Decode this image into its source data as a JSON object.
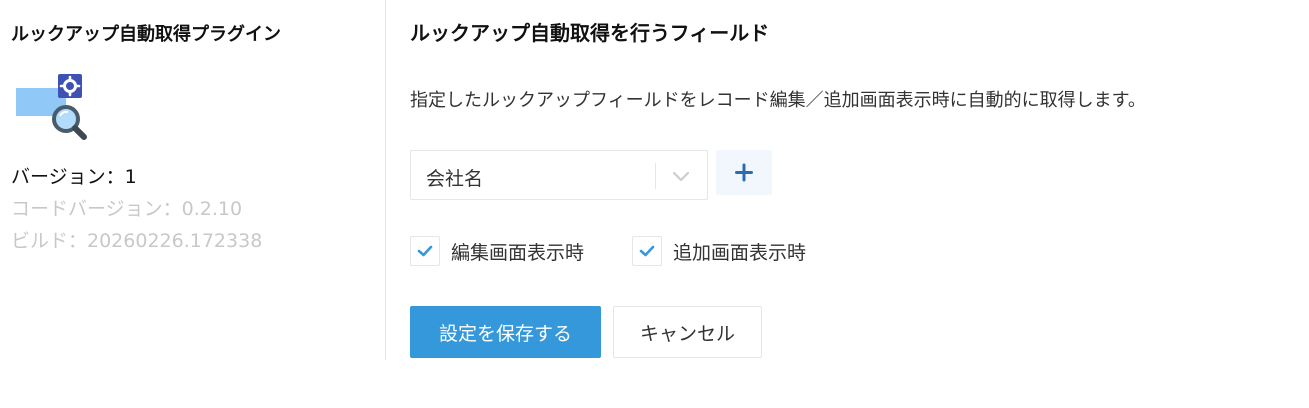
{
  "sidebar": {
    "plugin_name": "ルックアップ自動取得プラグイン",
    "icon": "lookup-search-settings-icon",
    "version_label": "バージョン：1",
    "code_version_label": "コードバージョン：0.2.10",
    "build_label": "ビルド：20260226.172338"
  },
  "main": {
    "title": "ルックアップ自動取得を行うフィールド",
    "description": "指定したルックアップフィールドをレコード編集／追加画面表示時に自動的に取得します。",
    "field_select": {
      "value": "会社名"
    },
    "checkboxes": [
      {
        "label": "編集画面表示時",
        "checked": true
      },
      {
        "label": "追加画面表示時",
        "checked": true
      }
    ],
    "save_label": "設定を保存する",
    "cancel_label": "キャンセル"
  },
  "colors": {
    "primary": "#3498db",
    "check": "#3498db",
    "border": "#e3e7e8",
    "muted_text": "#c8c8c8",
    "icon_gear_bg": "#3f51b5",
    "icon_card": "#90c8f8"
  }
}
